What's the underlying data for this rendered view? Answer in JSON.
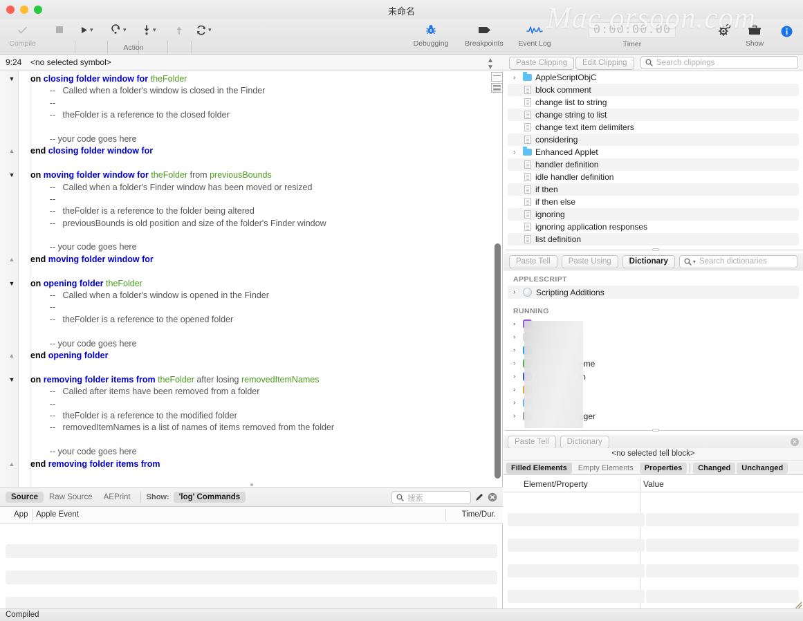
{
  "window": {
    "title": "未命名",
    "watermark": "Mac orsoon.com",
    "status": "Compiled"
  },
  "toolbar": {
    "compile_label": "Compile",
    "action_label": "Action",
    "debugging_label": "Debugging",
    "breakpoints_label": "Breakpoints",
    "eventlog_label": "Event Log",
    "timer_label": "Timer",
    "timer_value": "0:00:00.00",
    "show_label": "Show",
    "icons": {
      "compile": "checkmark-icon",
      "stop": "stop-icon",
      "run": "play-icon",
      "record": "record-icon",
      "step_in": "step-in-icon",
      "step_out": "step-out-icon",
      "refresh": "refresh-icon",
      "debugging": "bug-icon",
      "breakpoints": "tag-icon",
      "eventlog": "waveform-icon",
      "gear": "gear-icon",
      "toolbox": "toolbox-icon",
      "info": "info-icon"
    }
  },
  "symbol_bar": {
    "position": "9:24",
    "symbol": "<no selected symbol>"
  },
  "clipping_bar": {
    "paste_clipping": "Paste Clipping",
    "edit_clipping": "Edit Clipping",
    "search_placeholder": "Search clippings"
  },
  "editor": {
    "lines": [
      {
        "fold": "down",
        "segs": [
          {
            "t": "on ",
            "c": "blk"
          },
          {
            "t": "closing folder window for ",
            "c": "kw"
          },
          {
            "t": "theFolder",
            "c": "var"
          }
        ]
      },
      {
        "fold": "",
        "segs": [
          {
            "t": "        --   Called when a folder's window is closed in the Finder",
            "c": "cmt"
          }
        ]
      },
      {
        "fold": "",
        "segs": [
          {
            "t": "        --",
            "c": "cmt"
          }
        ]
      },
      {
        "fold": "",
        "segs": [
          {
            "t": "        --   theFolder is a reference to the closed folder",
            "c": "cmt"
          }
        ]
      },
      {
        "fold": "",
        "segs": [
          {
            "t": "",
            "c": "cmt"
          }
        ]
      },
      {
        "fold": "",
        "segs": [
          {
            "t": "        -- your code goes here",
            "c": "cmt"
          }
        ]
      },
      {
        "fold": "up",
        "segs": [
          {
            "t": "end ",
            "c": "blk"
          },
          {
            "t": "closing folder window for",
            "c": "kw"
          }
        ]
      },
      {
        "fold": "",
        "segs": [
          {
            "t": "",
            "c": "cmt"
          }
        ]
      },
      {
        "fold": "down",
        "segs": [
          {
            "t": "on ",
            "c": "blk"
          },
          {
            "t": "moving folder window for ",
            "c": "kw"
          },
          {
            "t": "theFolder",
            "c": "var"
          },
          {
            "t": " from ",
            "c": "cmt"
          },
          {
            "t": "previousBounds",
            "c": "var"
          }
        ]
      },
      {
        "fold": "",
        "segs": [
          {
            "t": "        --   Called when a folder's Finder window has been moved or resized",
            "c": "cmt"
          }
        ]
      },
      {
        "fold": "",
        "segs": [
          {
            "t": "        --",
            "c": "cmt"
          }
        ]
      },
      {
        "fold": "",
        "segs": [
          {
            "t": "        --   theFolder is a reference to the folder being altered",
            "c": "cmt"
          }
        ]
      },
      {
        "fold": "",
        "segs": [
          {
            "t": "        --   previousBounds is old position and size of the folder's Finder window",
            "c": "cmt"
          }
        ]
      },
      {
        "fold": "",
        "segs": [
          {
            "t": "",
            "c": "cmt"
          }
        ]
      },
      {
        "fold": "",
        "segs": [
          {
            "t": "        -- your code goes here",
            "c": "cmt"
          }
        ]
      },
      {
        "fold": "up",
        "segs": [
          {
            "t": "end ",
            "c": "blk"
          },
          {
            "t": "moving folder window for",
            "c": "kw"
          }
        ]
      },
      {
        "fold": "",
        "segs": [
          {
            "t": "",
            "c": "cmt"
          }
        ]
      },
      {
        "fold": "down",
        "segs": [
          {
            "t": "on ",
            "c": "blk"
          },
          {
            "t": "opening folder ",
            "c": "kw"
          },
          {
            "t": "theFolder",
            "c": "var"
          }
        ]
      },
      {
        "fold": "",
        "segs": [
          {
            "t": "        --   Called when a folder's window is opened in the Finder",
            "c": "cmt"
          }
        ]
      },
      {
        "fold": "",
        "segs": [
          {
            "t": "        --",
            "c": "cmt"
          }
        ]
      },
      {
        "fold": "",
        "segs": [
          {
            "t": "        --   theFolder is a reference to the opened folder",
            "c": "cmt"
          }
        ]
      },
      {
        "fold": "",
        "segs": [
          {
            "t": "",
            "c": "cmt"
          }
        ]
      },
      {
        "fold": "",
        "segs": [
          {
            "t": "        -- your code goes here",
            "c": "cmt"
          }
        ]
      },
      {
        "fold": "up",
        "segs": [
          {
            "t": "end ",
            "c": "blk"
          },
          {
            "t": "opening folder",
            "c": "kw"
          }
        ]
      },
      {
        "fold": "",
        "segs": [
          {
            "t": "",
            "c": "cmt"
          }
        ]
      },
      {
        "fold": "down",
        "segs": [
          {
            "t": "on ",
            "c": "blk"
          },
          {
            "t": "removing folder items from ",
            "c": "kw"
          },
          {
            "t": "theFolder",
            "c": "var"
          },
          {
            "t": " after losing ",
            "c": "cmt"
          },
          {
            "t": "removedItemNames",
            "c": "var"
          }
        ]
      },
      {
        "fold": "",
        "segs": [
          {
            "t": "        --   Called after items have been removed from a folder",
            "c": "cmt"
          }
        ]
      },
      {
        "fold": "",
        "segs": [
          {
            "t": "        --",
            "c": "cmt"
          }
        ]
      },
      {
        "fold": "",
        "segs": [
          {
            "t": "        --   theFolder is a reference to the modified folder",
            "c": "cmt"
          }
        ]
      },
      {
        "fold": "",
        "segs": [
          {
            "t": "        --   removedItemNames is a list of names of items removed from the folder",
            "c": "cmt"
          }
        ]
      },
      {
        "fold": "",
        "segs": [
          {
            "t": "",
            "c": "cmt"
          }
        ]
      },
      {
        "fold": "",
        "segs": [
          {
            "t": "        -- your code goes here",
            "c": "cmt"
          }
        ]
      },
      {
        "fold": "up",
        "segs": [
          {
            "t": "end ",
            "c": "blk"
          },
          {
            "t": "removing folder items from",
            "c": "kw"
          }
        ]
      }
    ]
  },
  "clippings": [
    {
      "label": "AppleScriptObjC",
      "type": "folder",
      "alt": false
    },
    {
      "label": "block comment",
      "type": "doc",
      "alt": true
    },
    {
      "label": "change list to string",
      "type": "doc",
      "alt": false
    },
    {
      "label": "change string to list",
      "type": "doc",
      "alt": true
    },
    {
      "label": "change text item delimiters",
      "type": "doc",
      "alt": false
    },
    {
      "label": "considering",
      "type": "doc",
      "alt": true
    },
    {
      "label": "Enhanced Applet",
      "type": "folder",
      "alt": false
    },
    {
      "label": "handler definition",
      "type": "doc",
      "alt": true
    },
    {
      "label": "idle handler definition",
      "type": "doc",
      "alt": false
    },
    {
      "label": "if then",
      "type": "doc",
      "alt": true
    },
    {
      "label": "if then else",
      "type": "doc",
      "alt": false
    },
    {
      "label": "ignoring",
      "type": "doc",
      "alt": true
    },
    {
      "label": "ignoring application responses",
      "type": "doc",
      "alt": false
    },
    {
      "label": "list definition",
      "type": "doc",
      "alt": true
    }
  ],
  "dictionary_bar": {
    "paste_tell": "Paste Tell",
    "paste_using": "Paste Using",
    "dictionary": "Dictionary",
    "search_placeholder": "Search dictionaries"
  },
  "dictionary": {
    "applescript_header": "APPLESCRIPT",
    "scripting_additions": "Scripting Additions",
    "running_header": "RUNNING",
    "running_items": [
      {
        "label": "",
        "color": "#9b59d0"
      },
      {
        "label": "",
        "color": "#d9d9d9"
      },
      {
        "label": "",
        "color": "#2c9ae0"
      },
      {
        "label": "ome",
        "color": "#4caf50"
      },
      {
        "label": "m",
        "color": "#3f51b5"
      },
      {
        "label": "",
        "color": "#d8a43c"
      },
      {
        "label": "",
        "color": "#6cb3e8"
      },
      {
        "label": "gger",
        "color": "#9e9e9e"
      }
    ]
  },
  "result_panel": {
    "paste_tell": "Paste Tell",
    "dictionary": "Dictionary",
    "tell_block": "<no selected tell block>",
    "tabs": [
      {
        "label": "Filled Elements",
        "state": "on"
      },
      {
        "label": "Empty Elements",
        "state": "off"
      },
      {
        "label": "Properties",
        "state": "on2"
      },
      {
        "label": "Changed",
        "state": "on2"
      },
      {
        "label": "Unchanged",
        "state": "on2"
      }
    ],
    "col_element": "Element/Property",
    "col_value": "Value"
  },
  "log_panel": {
    "tabs": [
      {
        "label": "Source",
        "state": "on"
      },
      {
        "label": "Raw Source",
        "state": "off"
      },
      {
        "label": "AEPrint",
        "state": "off"
      }
    ],
    "show_label": "Show:",
    "show_value": "'log' Commands",
    "search_placeholder": "搜索",
    "col_app": "App",
    "col_event": "Apple Event",
    "col_time": "Time/Dur."
  }
}
